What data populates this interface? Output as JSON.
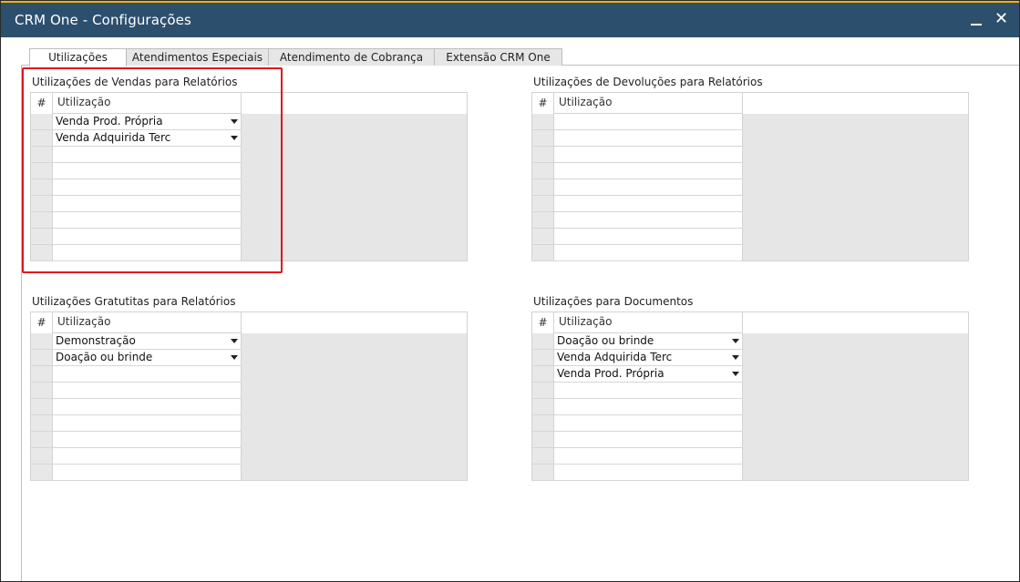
{
  "window": {
    "title": "CRM One - Configurações",
    "minimize_icon": "minimize-icon",
    "close_label": "✕"
  },
  "tabs": [
    {
      "label": "Utilizações",
      "active": true
    },
    {
      "label": "Atendimentos Especiais",
      "active": false
    },
    {
      "label": "Atendimento de Cobrança",
      "active": false
    },
    {
      "label": "Extensão CRM One",
      "active": false
    }
  ],
  "column_headers": {
    "hash": "#",
    "utilizacao": "Utilização"
  },
  "sections": {
    "vendas": {
      "title": "Utilizações de Vendas para Relatórios",
      "rows": [
        "Venda Prod. Própria",
        "Venda Adquirida Terc",
        "",
        "",
        "",
        "",
        "",
        "",
        ""
      ]
    },
    "devolucoes": {
      "title": "Utilizações de Devoluções para Relatórios",
      "rows": [
        "",
        "",
        "",
        "",
        "",
        "",
        "",
        "",
        ""
      ]
    },
    "gratuitas": {
      "title": "Utilizações Gratutitas para Relatórios",
      "rows": [
        "Demonstração",
        "Doação ou brinde",
        "",
        "",
        "",
        "",
        "",
        "",
        ""
      ]
    },
    "documentos": {
      "title": "Utilizações para Documentos",
      "rows": [
        "Doação ou brinde",
        "Venda Adquirida Terc",
        "Venda Prod. Própria",
        "",
        "",
        "",
        "",
        "",
        ""
      ]
    }
  },
  "colors": {
    "titlebar": "#2c4f6e",
    "accent_border": "#f0b400",
    "highlight": "#e0141e"
  }
}
